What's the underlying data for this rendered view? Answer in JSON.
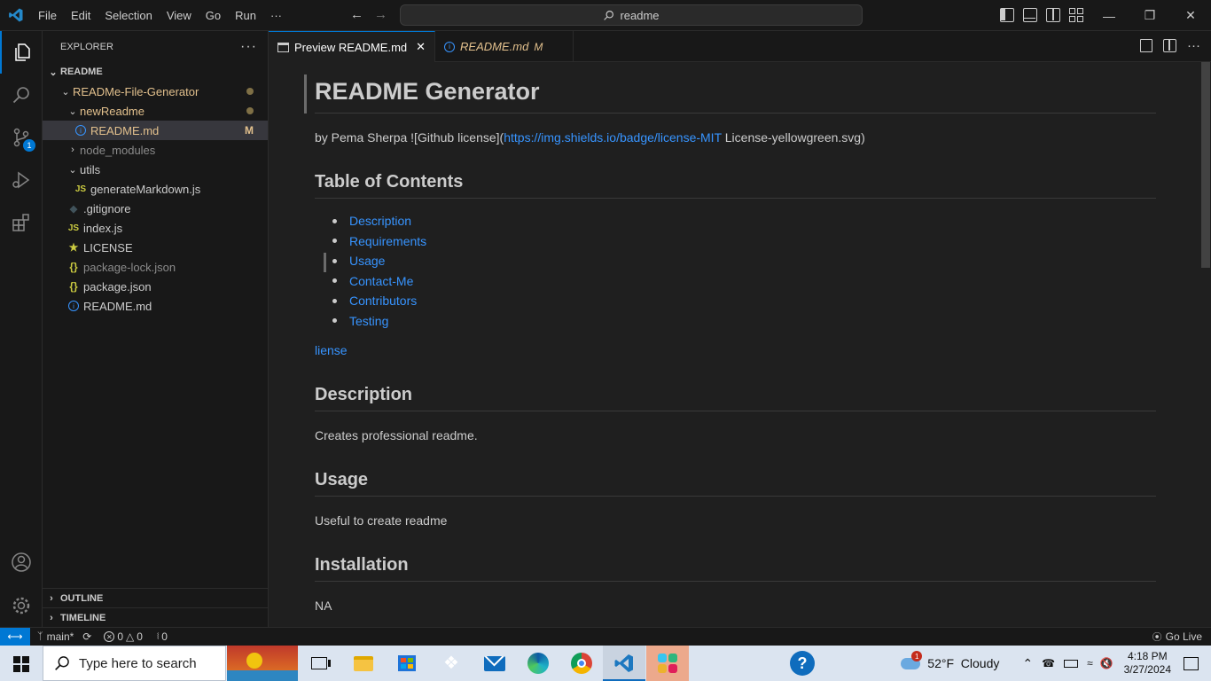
{
  "menu": [
    "File",
    "Edit",
    "Selection",
    "View",
    "Go",
    "Run",
    "···"
  ],
  "search": {
    "text": "readme"
  },
  "window_controls": [
    "minimize",
    "restore",
    "close"
  ],
  "activity": {
    "scm_badge": "1"
  },
  "explorer": {
    "title": "EXPLORER",
    "root": "README",
    "items": [
      {
        "label": "READMe-File-Generator",
        "type": "folder",
        "status": "dot",
        "color": "#e2c08d"
      },
      {
        "label": "newReadme",
        "type": "folder",
        "status": "dot",
        "color": "#e2c08d"
      },
      {
        "label": "README.md",
        "type": "md",
        "status": "M",
        "color": "#e2c08d"
      },
      {
        "label": "node_modules",
        "type": "folder-closed",
        "color": "#8b8b8b"
      },
      {
        "label": "utils",
        "type": "folder",
        "color": "#cccccc"
      },
      {
        "label": "generateMarkdown.js",
        "type": "js",
        "color": "#cccccc"
      },
      {
        "label": ".gitignore",
        "type": "git",
        "color": "#cccccc"
      },
      {
        "label": "index.js",
        "type": "js",
        "color": "#cccccc"
      },
      {
        "label": "LICENSE",
        "type": "license",
        "color": "#cccccc"
      },
      {
        "label": "package-lock.json",
        "type": "json",
        "color": "#8b8b8b"
      },
      {
        "label": "package.json",
        "type": "json",
        "color": "#cccccc"
      },
      {
        "label": "README.md",
        "type": "md",
        "color": "#cccccc"
      }
    ],
    "outline": "OUTLINE",
    "timeline": "TIMELINE"
  },
  "tabs": [
    {
      "label": "Preview README.md"
    },
    {
      "label": "README.md",
      "status": "M"
    }
  ],
  "doc": {
    "title": "README Generator",
    "byline_pre": "by Pema Sherpa ![Github license](",
    "byline_link": "https://img.shields.io/badge/license-MIT",
    "byline_post": " License-yellowgreen.svg)",
    "toc_heading": "Table of Contents",
    "toc": [
      "Description",
      "Requirements",
      "Usage",
      "Contact-Me",
      "Contributors",
      "Testing"
    ],
    "liense": "liense",
    "desc_heading": "Description",
    "desc_text": "Creates professional readme.",
    "usage_heading": "Usage",
    "usage_text": "Useful to create readme",
    "install_heading": "Installation",
    "install_text": "NA"
  },
  "status": {
    "branch": "main*",
    "errors": "0",
    "warnings": "0",
    "ports": "0",
    "golive": "Go Live"
  },
  "taskbar": {
    "search_placeholder": "Type here to search",
    "weather": "52°F  Cloudy",
    "weather_badge": "1",
    "time": "4:18 PM",
    "date": "3/27/2024"
  }
}
